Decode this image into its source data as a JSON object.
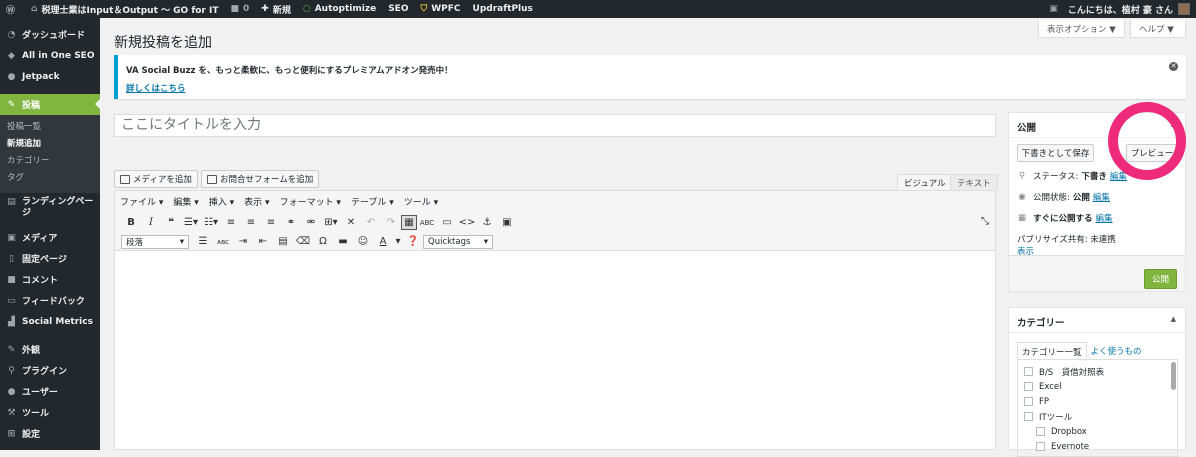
{
  "adminbar": {
    "site": "税理士業はInput＆Output 〜 GO for IT",
    "comments": "0",
    "new": "新規",
    "autoptimize": "Autoptimize",
    "seo": "SEO",
    "wpfc": "WPFC",
    "updraft": "UpdraftPlus",
    "greeting": "こんにちは、植村 豪 さん"
  },
  "menu": {
    "items": [
      {
        "label": "ダッシュボード",
        "icon": "dashboard-icon",
        "glyph": "◔"
      },
      {
        "label": "All in One SEO",
        "icon": "shield-icon",
        "glyph": "◆"
      },
      {
        "label": "Jetpack",
        "icon": "jetpack-icon",
        "glyph": "●"
      }
    ],
    "posts": {
      "label": "投稿",
      "icon": "pin-icon",
      "glyph": "✎"
    },
    "sub": [
      "投稿一覧",
      "新規追加",
      "カテゴリー",
      "タグ"
    ],
    "items2": [
      {
        "label": "ランディングページ",
        "icon": "landing-icon",
        "glyph": "▤"
      },
      {
        "label": "メディア",
        "icon": "media-icon",
        "glyph": "▣"
      },
      {
        "label": "固定ページ",
        "icon": "page-icon",
        "glyph": "▯"
      },
      {
        "label": "コメント",
        "icon": "comment-icon",
        "glyph": "■"
      },
      {
        "label": "フィードバック",
        "icon": "feedback-icon",
        "glyph": "▭"
      },
      {
        "label": "Social Metrics",
        "icon": "chart-icon",
        "glyph": "▟"
      },
      {
        "label": "外観",
        "icon": "appearance-icon",
        "glyph": "✎"
      },
      {
        "label": "プラグイン",
        "icon": "plugin-icon",
        "glyph": "⚲"
      },
      {
        "label": "ユーザー",
        "icon": "user-icon",
        "glyph": "●"
      },
      {
        "label": "ツール",
        "icon": "tool-icon",
        "glyph": "⚒"
      },
      {
        "label": "設定",
        "icon": "settings-icon",
        "glyph": "⊞"
      }
    ]
  },
  "screen": {
    "options": "表示オプション ▼",
    "help": "ヘルプ ▼"
  },
  "page": {
    "title": "新規投稿を追加"
  },
  "notice": {
    "text": "VA Social Buzz を、もっと柔軟に、もっと便利にするプレミアムアドオン発売中！",
    "link": "詳しくはこちら"
  },
  "post": {
    "title_placeholder": "ここにタイトルを入力"
  },
  "editor": {
    "add_media": "メディアを追加",
    "add_form": "お問合せフォームを追加",
    "tab_visual": "ビジュアル",
    "tab_text": "テキスト",
    "menus": [
      "ファイル ▾",
      "編集 ▾",
      "挿入 ▾",
      "表示 ▾",
      "フォーマット ▾",
      "テーブル ▾",
      "ツール ▾"
    ],
    "format": "段落",
    "quicktags": "Quicktags"
  },
  "publish": {
    "title": "公開",
    "save_draft": "下書きとして保存",
    "preview": "プレビュー",
    "status_label": "ステータス:",
    "status_value": "下書き",
    "visibility_label": "公開状態:",
    "visibility_value": "公開",
    "schedule": "すぐに公開する",
    "edit": "編集",
    "publicize": "パブリサイズ共有: 未連携",
    "show": "表示",
    "publish_btn": "公開"
  },
  "category": {
    "title": "カテゴリー",
    "tab_all": "カテゴリー一覧",
    "tab_popular": "よく使うもの",
    "items": [
      "B/S　貸借対照表",
      "Excel",
      "FP",
      "ITツール",
      "Dropbox",
      "Evernote"
    ]
  }
}
